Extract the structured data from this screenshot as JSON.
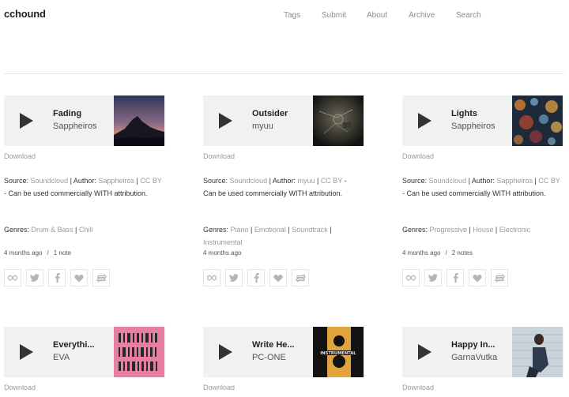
{
  "site": {
    "logo": "cchound"
  },
  "nav": [
    {
      "label": "Tags"
    },
    {
      "label": "Submit"
    },
    {
      "label": "About"
    },
    {
      "label": "Archive"
    },
    {
      "label": "Search"
    }
  ],
  "cards": [
    {
      "title": "Fading",
      "artist": "Sappheiros",
      "download": "Download",
      "source_prefix": "Source: ",
      "source_name": "Soundcloud",
      "author_prefix": " | Author: ",
      "author_name": "Sappheiros",
      "license_sep": " | ",
      "license": "CC BY",
      "license_text": " - Can be used commercially WITH attribution.",
      "genres_prefix": "Genres: ",
      "genres": [
        "Drum & Bass",
        "Chill"
      ],
      "time": "4 months ago",
      "meta_sep": "/",
      "notes": "1 note",
      "cover": "mountain-sunset"
    },
    {
      "title": "Outsider",
      "artist": "myuu",
      "download": "Download",
      "source_prefix": "Source: ",
      "source_name": "Soundcloud",
      "author_prefix": " | Author: ",
      "author_name": "myuu",
      "license_sep": " | ",
      "license": "CC BY",
      "license_text": " - Can be used commercially WITH attribution.",
      "genres_prefix": "Genres: ",
      "genres": [
        "Piano",
        "Emotional",
        "Soundtrack",
        "Instrumental"
      ],
      "time": "4 months ago",
      "meta_sep": "",
      "notes": "",
      "cover": "dark-texture"
    },
    {
      "title": "Lights",
      "artist": "Sappheiros",
      "download": "Download",
      "source_prefix": "Source: ",
      "source_name": "Soundcloud",
      "author_prefix": " | Author: ",
      "author_name": "Sappheiros",
      "license_sep": " | ",
      "license": "CC BY",
      "license_text": " - Can be used commercially WITH attribution.",
      "genres_prefix": "Genres: ",
      "genres": [
        "Progressive",
        "House",
        "Electronic"
      ],
      "time": "4 months ago",
      "meta_sep": "/",
      "notes": "2 notes",
      "cover": "bokeh-lights"
    },
    {
      "title": "Everythi...",
      "artist": "EVA",
      "download": "Download",
      "cover": "pink-pattern"
    },
    {
      "title": "Write He...",
      "artist": "PC-ONE",
      "download": "Download",
      "cover": "instrumental-8"
    },
    {
      "title": "Happy In...",
      "artist": "GarnaVutka",
      "download": "Download",
      "cover": "woman-photo"
    }
  ],
  "instrumental_cover_text": "INSTRUMENTAL",
  "action_icons": [
    "infinity-icon",
    "twitter-icon",
    "facebook-icon",
    "heart-icon",
    "reblog-icon"
  ],
  "colors": {
    "muted_link": "#9a9a9a",
    "player_bg": "#f1f1f1",
    "text": "#222222"
  }
}
